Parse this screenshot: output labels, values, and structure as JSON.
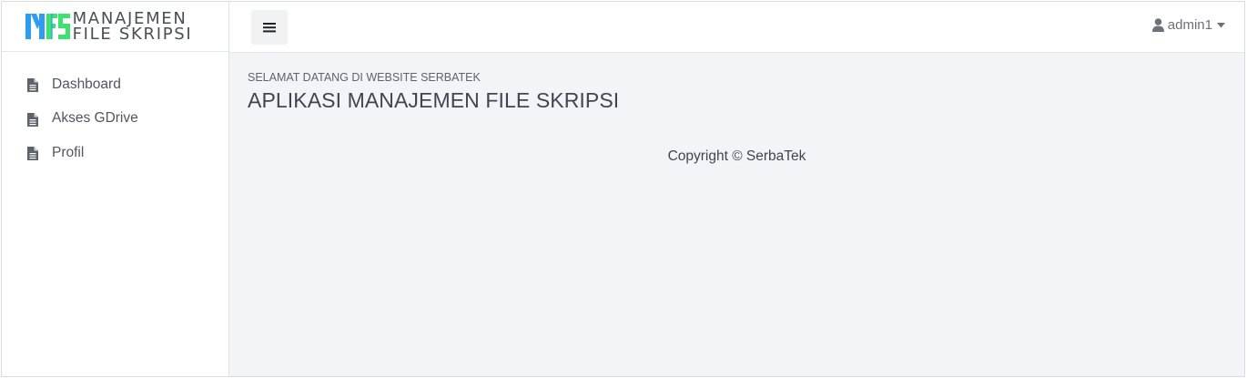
{
  "brand": {
    "line1": "MANAJEMEN",
    "line2": "FILE SKRIPSI",
    "logo_colors": {
      "blue": "#2e9cf0",
      "green": "#39e36e"
    }
  },
  "sidebar": {
    "items": [
      {
        "label": "Dashboard",
        "icon": "file-icon"
      },
      {
        "label": "Akses GDrive",
        "icon": "file-icon"
      },
      {
        "label": "Profil",
        "icon": "file-icon"
      }
    ]
  },
  "header": {
    "toggle_icon": "hamburger-icon",
    "user": {
      "name": "admin1",
      "icon": "user-icon",
      "caret": "caret-down-icon"
    }
  },
  "main": {
    "subtitle": "SELAMAT DATANG DI WEBSITE SERBATEK",
    "title": "APLIKASI MANAJEMEN FILE SKRIPSI"
  },
  "footer": {
    "copyright": "Copyright © SerbaTek"
  },
  "colors": {
    "content_bg": "#f3f4f8",
    "sidebar_bg": "#ffffff",
    "text": "#3f4650"
  }
}
